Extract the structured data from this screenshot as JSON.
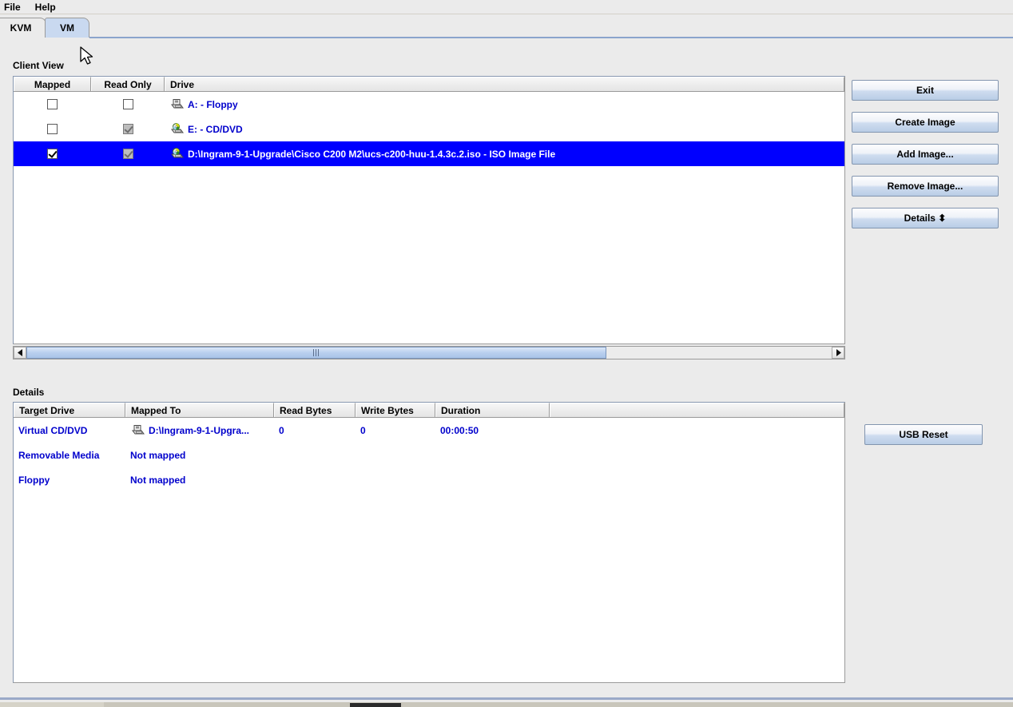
{
  "menubar": {
    "items": [
      {
        "label": "File",
        "name": "menu-file"
      },
      {
        "label": "Help",
        "name": "menu-help"
      }
    ]
  },
  "tabs": [
    {
      "label": "KVM",
      "name": "tab-kvm",
      "selected": false
    },
    {
      "label": "VM",
      "name": "tab-vm",
      "selected": true
    }
  ],
  "client_view": {
    "label": "Client View",
    "columns": [
      "Mapped",
      "Read Only",
      "Drive"
    ],
    "rows": [
      {
        "mapped": false,
        "mapped_enabled": true,
        "read_only": false,
        "read_only_enabled": true,
        "drive": "A: - Floppy",
        "icon": "floppy-drive-icon",
        "selected": false
      },
      {
        "mapped": false,
        "mapped_enabled": true,
        "read_only": true,
        "read_only_enabled": false,
        "drive": "E: - CD/DVD",
        "icon": "cd-drive-icon",
        "selected": false
      },
      {
        "mapped": true,
        "mapped_enabled": true,
        "read_only": true,
        "read_only_enabled": false,
        "drive": "D:\\Ingram-9-1-Upgrade\\Cisco C200 M2\\ucs-c200-huu-1.4.3c.2.iso - ISO Image File",
        "icon": "cd-drive-icon",
        "selected": true
      }
    ],
    "scrollbar": {
      "left_arrow": "◀",
      "right_arrow": "▶",
      "thumb_width_percent": 72
    }
  },
  "details": {
    "label": "Details",
    "columns": [
      "Target Drive",
      "Mapped To",
      "Read Bytes",
      "Write Bytes",
      "Duration"
    ],
    "rows": [
      {
        "target_drive": "Virtual CD/DVD",
        "mapped_to": "D:\\Ingram-9-1-Upgra...",
        "icon": "floppy-drive-icon",
        "read_bytes": "0",
        "write_bytes": "0",
        "duration": "00:00:50"
      },
      {
        "target_drive": "Removable Media",
        "mapped_to": "Not mapped",
        "icon": "",
        "read_bytes": "",
        "write_bytes": "",
        "duration": ""
      },
      {
        "target_drive": "Floppy",
        "mapped_to": "Not mapped",
        "icon": "",
        "read_bytes": "",
        "write_bytes": "",
        "duration": ""
      }
    ]
  },
  "buttons": {
    "exit": "Exit",
    "create_image": "Create Image",
    "add_image": "Add Image...",
    "remove_image": "Remove Image...",
    "details": "Details ⬍",
    "usb_reset": "USB Reset"
  },
  "colors": {
    "selection_blue": "#0000ff",
    "link_blue": "#0000cc",
    "panel_bg": "#ebebeb",
    "tab_active": "#c9d9f0",
    "accent_line": "#8ba4cc"
  }
}
